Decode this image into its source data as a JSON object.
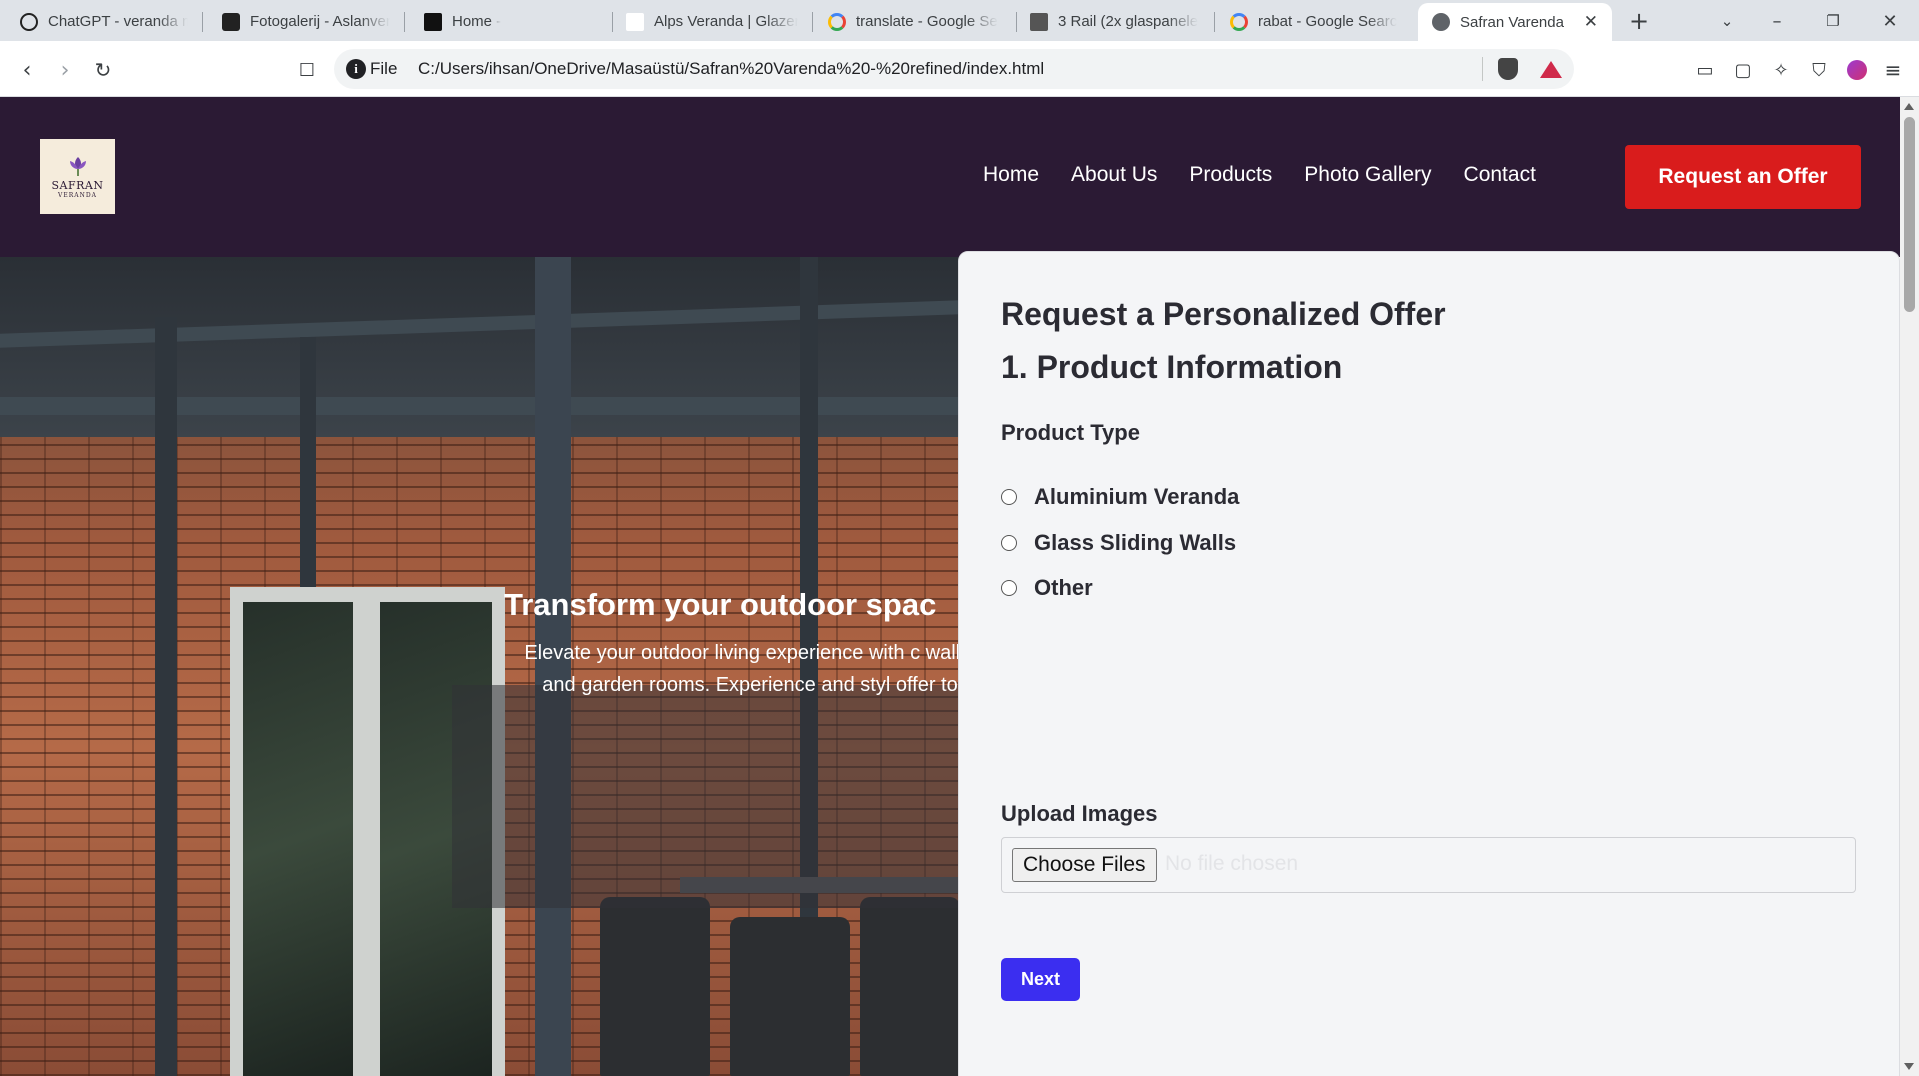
{
  "browser": {
    "tabs": [
      {
        "title": "ChatGPT - veranda m",
        "icon": "chatgpt-icon"
      },
      {
        "title": "Fotogalerij - Aslanver",
        "icon": "site-favicon"
      },
      {
        "title": "Home -",
        "icon": "site-favicon"
      },
      {
        "title": "Alps Veranda | Glazer",
        "icon": "alps-favicon"
      },
      {
        "title": "translate - Google Se",
        "icon": "google-icon"
      },
      {
        "title": "3 Rail (2x glaspaneler",
        "icon": "site-favicon"
      },
      {
        "title": "rabat - Google Searc",
        "icon": "google-icon"
      },
      {
        "title": "Safran Varenda",
        "icon": "globe-icon",
        "active": true
      }
    ],
    "address": {
      "scheme_label": "File",
      "url": "C:/Users/ihsan/OneDrive/Masaüstü/Safran%20Varenda%20-%20refined/index.html"
    }
  },
  "site": {
    "logo": {
      "line1": "SAFRAN",
      "line2": "VERANDA"
    },
    "nav": [
      "Home",
      "About Us",
      "Products",
      "Photo Gallery",
      "Contact"
    ],
    "cta_label": "Request an Offer",
    "hero": {
      "title": "Transform your outdoor spac",
      "text": "Elevate your outdoor living experience with c walls, and garden rooms. Experience and styl offer to"
    },
    "form": {
      "title": "Request a Personalized Offer",
      "step": "1. Product Information",
      "product_type_label": "Product Type",
      "options": [
        "Aluminium Veranda",
        "Glass Sliding Walls",
        "Other"
      ],
      "upload_label": "Upload Images",
      "file_button": "Choose Files",
      "file_status": "No file chosen",
      "next_label": "Next"
    }
  },
  "colors": {
    "header_bg": "#2b1a34",
    "cta": "#d91c1c",
    "next_button": "#3b2ef0",
    "card_bg": "#f4f5f7"
  }
}
